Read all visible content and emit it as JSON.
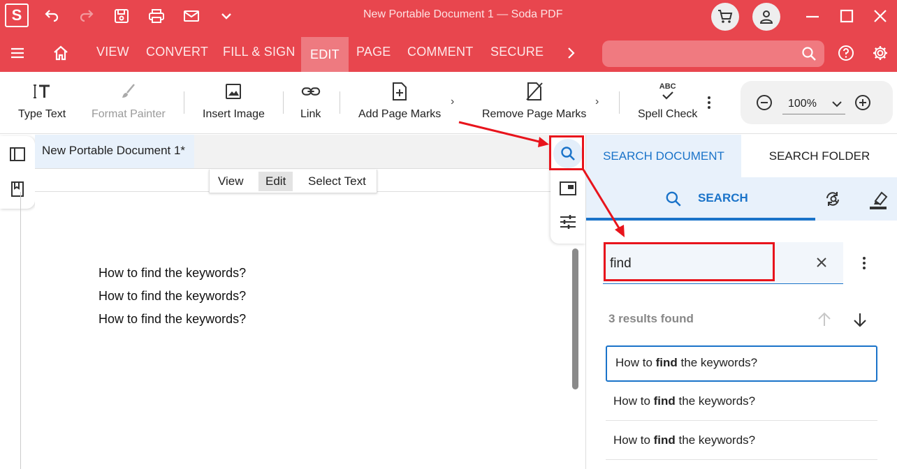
{
  "app": {
    "logo_letter": "S",
    "title": "New Portable Document 1   —   Soda PDF"
  },
  "menu": {
    "items": [
      "VIEW",
      "CONVERT",
      "FILL & SIGN",
      "EDIT",
      "PAGE",
      "COMMENT",
      "SECURE"
    ],
    "active": "EDIT"
  },
  "ribbon": {
    "type_text": "Type Text",
    "format_painter": "Format Painter",
    "insert_image": "Insert Image",
    "link": "Link",
    "add_page_marks": "Add Page Marks",
    "remove_page_marks": "Remove Page Marks",
    "spell_check": "Spell Check",
    "spell_icon_text": "ABC",
    "zoom": "100%"
  },
  "document": {
    "tab_title": "New Portable Document 1*",
    "modes": [
      "View",
      "Edit",
      "Select Text"
    ],
    "active_mode": "Edit",
    "lines": [
      "How to find the keywords?",
      "How to find the keywords?",
      "How to find the keywords?"
    ]
  },
  "panel": {
    "tab_document": "SEARCH DOCUMENT",
    "tab_folder": "SEARCH FOLDER",
    "search_label": "SEARCH",
    "query": "find",
    "results_count": "3 results found",
    "results": [
      {
        "before": "How to ",
        "match": "find",
        "after": " the keywords?"
      },
      {
        "before": "How to ",
        "match": "find",
        "after": " the keywords?"
      },
      {
        "before": "How to ",
        "match": "find",
        "after": " the keywords?"
      }
    ]
  },
  "colors": {
    "brand_red": "#e8464e",
    "accent_blue": "#1a73c9",
    "annotation_red": "#e8141c"
  }
}
